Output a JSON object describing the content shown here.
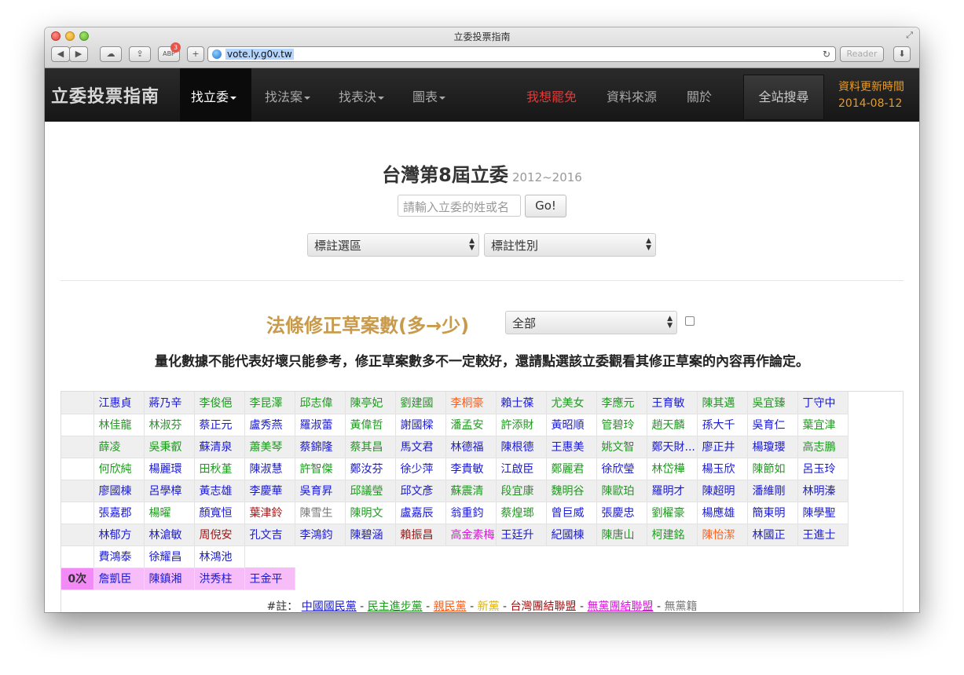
{
  "window": {
    "title": "立委投票指南",
    "url": "vote.ly.g0v.tw",
    "reader_label": "Reader",
    "adblock_badge": "3"
  },
  "navbar": {
    "brand": "立委投票指南",
    "items": [
      {
        "label": "找立委",
        "dropdown": true,
        "active": true
      },
      {
        "label": "找法案",
        "dropdown": true
      },
      {
        "label": "找表決",
        "dropdown": true
      },
      {
        "label": "圖表",
        "dropdown": true
      }
    ],
    "right_items": [
      {
        "label": "我想罷免",
        "color": "#e03a3a"
      },
      {
        "label": "資料來源"
      },
      {
        "label": "關於"
      }
    ],
    "search_button": "全站搜尋",
    "update_label": "資料更新時間",
    "update_date": "2014-08-12"
  },
  "main": {
    "title": "台灣第8屆立委",
    "subtitle": "2012~2016",
    "search_placeholder": "請輸入立委的姓或名",
    "go_label": "Go!",
    "select_district": "標註選區",
    "select_gender": "標註性別",
    "section_title": "法條修正草案數(多→少)",
    "filter_value": "全部",
    "notice": "量化數據不能代表好壞只能參考，修正草案數多不一定較好，還請點選該立委觀看其修正草案的內容再作論定。"
  },
  "colors": {
    "kmt": "#1a1ad4",
    "dpp": "#1f9a1f",
    "pfp": "#ff5e1a",
    "np": "#e0b300",
    "tsu": "#a51212",
    "nsu": "#e012e0",
    "ind": "#777777"
  },
  "legislator_rows": [
    {
      "label": "",
      "names": [
        [
          "江惠貞",
          "kmt"
        ],
        [
          "蔣乃辛",
          "kmt"
        ],
        [
          "李俊俋",
          "dpp"
        ],
        [
          "李昆澤",
          "dpp"
        ],
        [
          "邱志偉",
          "dpp"
        ],
        [
          "陳亭妃",
          "dpp"
        ],
        [
          "劉建國",
          "dpp"
        ],
        [
          "李桐豪",
          "pfp"
        ],
        [
          "賴士葆",
          "kmt"
        ],
        [
          "尤美女",
          "dpp"
        ],
        [
          "李應元",
          "dpp"
        ],
        [
          "王育敏",
          "kmt"
        ],
        [
          "陳其邁",
          "dpp"
        ],
        [
          "吳宜臻",
          "dpp"
        ],
        [
          "丁守中",
          "kmt"
        ]
      ]
    },
    {
      "label": "",
      "names": [
        [
          "林佳龍",
          "dpp"
        ],
        [
          "林淑芬",
          "dpp"
        ],
        [
          "蔡正元",
          "kmt"
        ],
        [
          "盧秀燕",
          "kmt"
        ],
        [
          "羅淑蕾",
          "kmt"
        ],
        [
          "黃偉哲",
          "dpp"
        ],
        [
          "謝國樑",
          "kmt"
        ],
        [
          "潘孟安",
          "dpp"
        ],
        [
          "許添財",
          "dpp"
        ],
        [
          "黃昭順",
          "kmt"
        ],
        [
          "管碧玲",
          "dpp"
        ],
        [
          "趙天麟",
          "dpp"
        ],
        [
          "孫大千",
          "kmt"
        ],
        [
          "吳育仁",
          "kmt"
        ],
        [
          "葉宜津",
          "dpp"
        ]
      ]
    },
    {
      "label": "",
      "names": [
        [
          "薛凌",
          "dpp"
        ],
        [
          "吳秉叡",
          "dpp"
        ],
        [
          "蘇清泉",
          "kmt"
        ],
        [
          "蕭美琴",
          "dpp"
        ],
        [
          "蔡錦隆",
          "kmt"
        ],
        [
          "蔡其昌",
          "dpp"
        ],
        [
          "馬文君",
          "kmt"
        ],
        [
          "林德福",
          "kmt"
        ],
        [
          "陳根德",
          "kmt"
        ],
        [
          "王惠美",
          "kmt"
        ],
        [
          "姚文智",
          "dpp"
        ],
        [
          "鄭天財...",
          "kmt"
        ],
        [
          "廖正井",
          "kmt"
        ],
        [
          "楊瓊瓔",
          "kmt"
        ],
        [
          "高志鵬",
          "dpp"
        ]
      ]
    },
    {
      "label": "",
      "names": [
        [
          "何欣純",
          "dpp"
        ],
        [
          "楊麗環",
          "kmt"
        ],
        [
          "田秋堇",
          "dpp"
        ],
        [
          "陳淑慧",
          "kmt"
        ],
        [
          "許智傑",
          "dpp"
        ],
        [
          "鄭汝芬",
          "kmt"
        ],
        [
          "徐少萍",
          "kmt"
        ],
        [
          "李貴敏",
          "kmt"
        ],
        [
          "江啟臣",
          "kmt"
        ],
        [
          "鄭麗君",
          "dpp"
        ],
        [
          "徐欣瑩",
          "kmt"
        ],
        [
          "林岱樺",
          "dpp"
        ],
        [
          "楊玉欣",
          "kmt"
        ],
        [
          "陳節如",
          "dpp"
        ],
        [
          "呂玉玲",
          "kmt"
        ]
      ]
    },
    {
      "label": "",
      "names": [
        [
          "廖國棟",
          "kmt"
        ],
        [
          "呂學樟",
          "kmt"
        ],
        [
          "黃志雄",
          "kmt"
        ],
        [
          "李慶華",
          "kmt"
        ],
        [
          "吳育昇",
          "kmt"
        ],
        [
          "邱議瑩",
          "dpp"
        ],
        [
          "邱文彥",
          "kmt"
        ],
        [
          "蘇震清",
          "dpp"
        ],
        [
          "段宜康",
          "dpp"
        ],
        [
          "魏明谷",
          "dpp"
        ],
        [
          "陳歐珀",
          "dpp"
        ],
        [
          "羅明才",
          "kmt"
        ],
        [
          "陳超明",
          "kmt"
        ],
        [
          "潘維剛",
          "kmt"
        ],
        [
          "林明溱",
          "kmt"
        ]
      ]
    },
    {
      "label": "",
      "names": [
        [
          "張嘉郡",
          "kmt"
        ],
        [
          "楊曜",
          "dpp"
        ],
        [
          "顏寬恒",
          "kmt"
        ],
        [
          "葉津鈴",
          "tsu"
        ],
        [
          "陳雪生",
          "ind"
        ],
        [
          "陳明文",
          "dpp"
        ],
        [
          "盧嘉辰",
          "kmt"
        ],
        [
          "翁重鈞",
          "kmt"
        ],
        [
          "蔡煌瑯",
          "dpp"
        ],
        [
          "曾巨威",
          "kmt"
        ],
        [
          "張慶忠",
          "kmt"
        ],
        [
          "劉櫂豪",
          "dpp"
        ],
        [
          "楊應雄",
          "kmt"
        ],
        [
          "簡東明",
          "kmt"
        ],
        [
          "陳學聖",
          "kmt"
        ]
      ]
    },
    {
      "label": "",
      "names": [
        [
          "林郁方",
          "kmt"
        ],
        [
          "林滄敏",
          "kmt"
        ],
        [
          "周倪安",
          "tsu"
        ],
        [
          "孔文吉",
          "kmt"
        ],
        [
          "李鴻鈞",
          "kmt"
        ],
        [
          "陳碧涵",
          "kmt"
        ],
        [
          "賴振昌",
          "tsu"
        ],
        [
          "高金素梅",
          "nsu"
        ],
        [
          "王廷升",
          "kmt"
        ],
        [
          "紀國棟",
          "kmt"
        ],
        [
          "陳唐山",
          "dpp"
        ],
        [
          "柯建銘",
          "dpp"
        ],
        [
          "陳怡潔",
          "pfp"
        ],
        [
          "林國正",
          "kmt"
        ],
        [
          "王進士",
          "kmt"
        ]
      ]
    },
    {
      "label": "",
      "names": [
        [
          "費鴻泰",
          "kmt"
        ],
        [
          "徐耀昌",
          "kmt"
        ],
        [
          "林鴻池",
          "kmt"
        ]
      ]
    },
    {
      "label": "0次",
      "names": [
        [
          "詹凱臣",
          "kmt"
        ],
        [
          "陳鎮湘",
          "kmt"
        ],
        [
          "洪秀柱",
          "kmt"
        ],
        [
          "王金平",
          "kmt"
        ]
      ]
    }
  ],
  "footnote": {
    "prefix": "#註：",
    "parties": [
      [
        "中國國民黨",
        "kmt"
      ],
      [
        "民主進步黨",
        "dpp"
      ],
      [
        "親民黨",
        "pfp"
      ],
      [
        "新黨",
        "np"
      ],
      [
        "台灣團結聯盟",
        "tsu"
      ],
      [
        "無黨團結聯盟",
        "nsu"
      ],
      [
        "無黨籍",
        "ind"
      ]
    ]
  }
}
